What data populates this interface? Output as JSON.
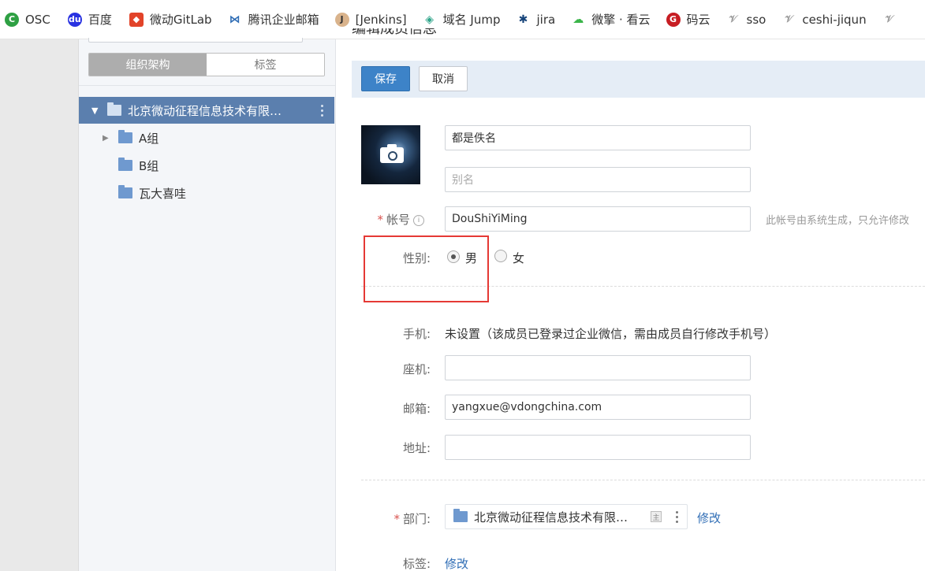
{
  "bookmarks": [
    {
      "label": "OSC",
      "icon": "osc-icon",
      "color": "#2ea043"
    },
    {
      "label": "百度",
      "icon": "baidu-icon",
      "color": "#2932e1"
    },
    {
      "label": "微动GitLab",
      "icon": "gitlab-icon",
      "color": "#e24329"
    },
    {
      "label": "腾讯企业邮箱",
      "icon": "tencent-mail-icon",
      "color": "#2f6db5"
    },
    {
      "label": "[Jenkins]",
      "icon": "jenkins-icon",
      "color": "#d24939"
    },
    {
      "label": "域名 Jump",
      "icon": "jump-icon",
      "color": "#2fa58a"
    },
    {
      "label": "jira",
      "icon": "jira-icon",
      "color": "#17447a"
    },
    {
      "label": "微擎 · 看云",
      "icon": "kancloud-icon",
      "color": "#3bb54a"
    },
    {
      "label": "码云",
      "icon": "gitee-icon",
      "color": "#c71d23"
    },
    {
      "label": "sso",
      "icon": "sso-icon",
      "color": "#999999"
    },
    {
      "label": "ceshi-jiqun",
      "icon": "ceshi-icon",
      "color": "#999999"
    },
    {
      "label": "",
      "icon": "bookmark-icon",
      "color": "#999999"
    }
  ],
  "sidebar": {
    "tabs": [
      {
        "label": "组织架构",
        "active": true
      },
      {
        "label": "标签",
        "active": false
      }
    ],
    "tree": {
      "root": "北京微动征程信息技术有限…",
      "children": [
        {
          "label": "A组",
          "has_children": true
        },
        {
          "label": "B组",
          "has_children": false
        },
        {
          "label": "瓦大喜哇",
          "has_children": false
        }
      ]
    }
  },
  "main": {
    "title": "编辑成员信息",
    "toolbar": {
      "save": "保存",
      "cancel": "取消"
    },
    "form": {
      "name_value": "都是佚名",
      "alias_placeholder": "别名",
      "account_label": "帐号",
      "account_value": "DouShiYiMing",
      "account_hint": "此帐号由系统生成，只允许修改",
      "gender_label": "性别:",
      "gender_options": [
        "男",
        "女"
      ],
      "gender_selected": "男",
      "phone_label": "手机:",
      "phone_value": "未设置（该成员已登录过企业微信，需由成员自行修改手机号）",
      "landline_label": "座机:",
      "landline_value": "",
      "email_label": "邮箱:",
      "email_value": "yangxue@vdongchina.com",
      "address_label": "地址:",
      "address_value": "",
      "dept_label": "部门:",
      "dept_value": "北京微动征程信息技术有限…",
      "dept_main_tag": "主",
      "dept_edit": "修改",
      "tags_label": "标签:",
      "tags_edit": "修改"
    }
  },
  "colors": {
    "primary": "#3d83c8",
    "tree_selected": "#5b7fae",
    "highlight_box": "#e53935",
    "link": "#2f6db5"
  }
}
